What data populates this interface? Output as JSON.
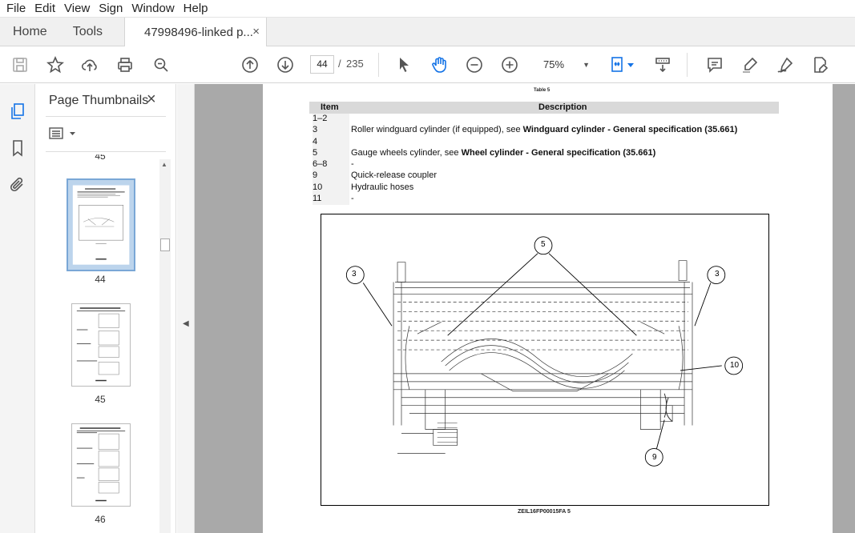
{
  "menu": [
    "File",
    "Edit",
    "View",
    "Sign",
    "Window",
    "Help"
  ],
  "tabs": {
    "home": "Home",
    "tools": "Tools",
    "document": "47998496-linked p...",
    "close": "×"
  },
  "toolbar": {
    "page_current": "44",
    "page_sep": "/",
    "page_total": "235",
    "zoom": "75%"
  },
  "panel": {
    "title": "Page Thumbnails",
    "close": "×",
    "thumbnails": [
      {
        "label": "45",
        "partial": true
      },
      {
        "label": "44",
        "selected": true
      },
      {
        "label": "45"
      },
      {
        "label": "46"
      }
    ]
  },
  "document": {
    "table_caption": "Table 5",
    "table": {
      "headers": [
        "Item",
        "Description"
      ],
      "rows": [
        {
          "item": "1–2",
          "desc": "",
          "bold": "",
          "suffix": ""
        },
        {
          "item": "3",
          "desc": "Roller windguard cylinder (if equipped), see ",
          "bold": "Windguard cylinder - General specification (35.661)",
          "suffix": ""
        },
        {
          "item": "4",
          "desc": "",
          "bold": "",
          "suffix": ""
        },
        {
          "item": "5",
          "desc": "Gauge wheels cylinder, see ",
          "bold": "Wheel cylinder - General specification (35.661)",
          "suffix": ""
        },
        {
          "item": "6–8",
          "desc": "-",
          "bold": "",
          "suffix": ""
        },
        {
          "item": "9",
          "desc": "Quick-release coupler",
          "bold": "",
          "suffix": ""
        },
        {
          "item": "10",
          "desc": "Hydraulic hoses",
          "bold": "",
          "suffix": ""
        },
        {
          "item": "11",
          "desc": "-",
          "bold": "",
          "suffix": ""
        }
      ]
    },
    "callouts": [
      "3",
      "5",
      "3",
      "10",
      "9"
    ],
    "figure_caption": "ZEIL16FP00015FA    5"
  }
}
